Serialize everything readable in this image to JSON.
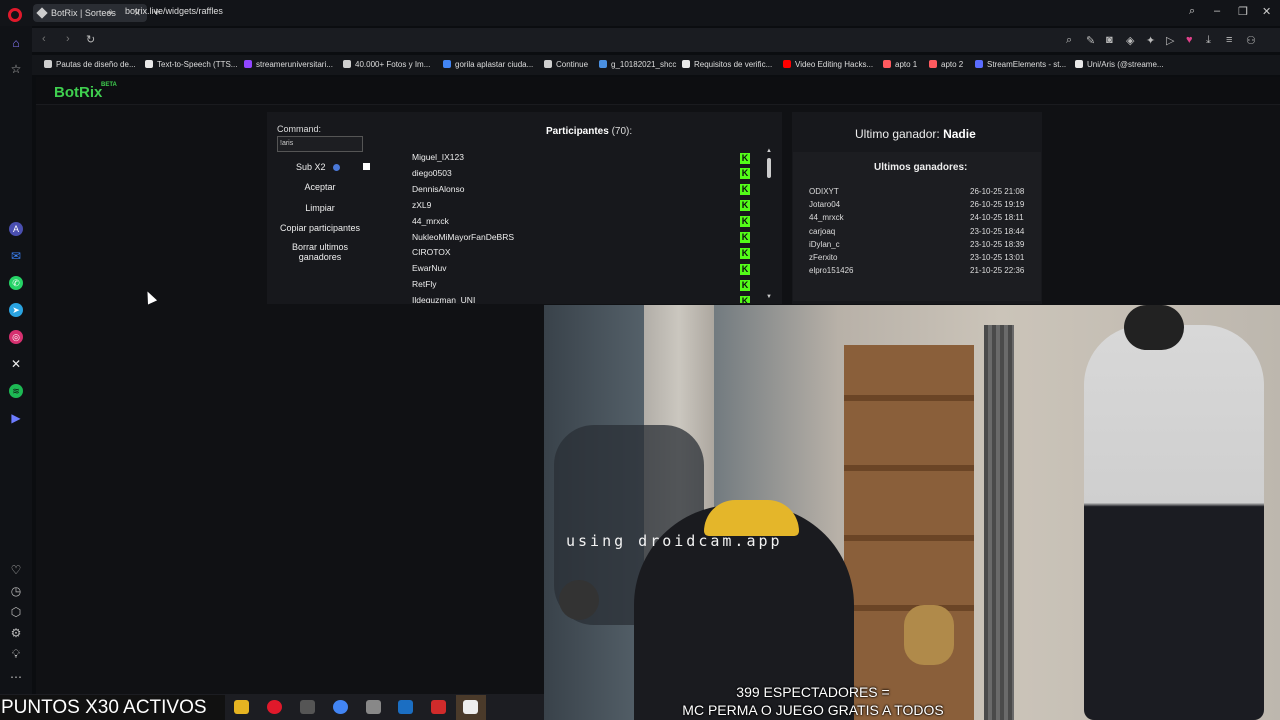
{
  "browser": {
    "tab_title": "BotRix | Sorteos",
    "tab_close": "✕",
    "new_tab": "+",
    "url": "botrix.live/widgets/raffles",
    "bookmarks": [
      {
        "label": "Pautas de diseño de...",
        "icon": "document-icon",
        "color": "#cfcfcf"
      },
      {
        "label": "Text-to-Speech (TTS...",
        "icon": "tts-icon",
        "color": "#e8e8e8"
      },
      {
        "label": "streameruniversitari...",
        "icon": "twitch-icon",
        "color": "#9146ff"
      },
      {
        "label": "40.000+ Fotos y Im...",
        "icon": "p-icon",
        "color": "#cfcfcf"
      },
      {
        "label": "gorila aplastar ciuda...",
        "icon": "google-icon",
        "color": "#4285f4"
      },
      {
        "label": "Continue",
        "icon": "document-icon",
        "color": "#cfcfcf"
      },
      {
        "label": "g_10182021_shcc",
        "icon": "cloud-icon",
        "color": "#4a90e2"
      },
      {
        "label": "Requisitos de verific...",
        "icon": "x-icon",
        "color": "#e8e8e8"
      },
      {
        "label": "Video Editing Hacks...",
        "icon": "youtube-icon",
        "color": "#ff0000"
      },
      {
        "label": "apto 1",
        "icon": "airbnb-icon",
        "color": "#ff5a5f"
      },
      {
        "label": "apto 2",
        "icon": "airbnb-icon",
        "color": "#ff5a5f"
      },
      {
        "label": "StreamElements - st...",
        "icon": "streamelements-icon",
        "color": "#5a6cff"
      },
      {
        "label": "Uni/Aris (@streame...",
        "icon": "tiktok-icon",
        "color": "#e8e8e8"
      }
    ]
  },
  "botrix": {
    "logo": "BotRix",
    "beta": "BETA"
  },
  "raffle": {
    "command_label": "Command:",
    "command_value": "!aris",
    "sub_label": "Sub X2",
    "accept": "Aceptar",
    "clear": "Limpiar",
    "copy": "Copiar participantes",
    "delete_winners": "Borrar ultimos ganadores",
    "participants_label": "Participantes",
    "participants_count": "(70):",
    "participants": [
      "Miguel_IX123",
      "diego0503",
      "DennisAlonso",
      "zXL9",
      "44_mrxck",
      "NukleoMiMayorFanDeBRS",
      "CIROTOX",
      "EwarNuv",
      "RetFly",
      "Ildeguzman_UNI"
    ]
  },
  "winners": {
    "last_winner_label": "Ultimo ganador:",
    "last_winner_name": "Nadie",
    "recent_title": "Ultimos ganadores:",
    "list": [
      {
        "name": "ODIXYT",
        "date": "26-10-25 21:08"
      },
      {
        "name": "Jotaro04",
        "date": "26-10-25 19:19"
      },
      {
        "name": "44_mrxck",
        "date": "24-10-25 18:11"
      },
      {
        "name": "carjoaq",
        "date": "23-10-25 18:44"
      },
      {
        "name": "iDylan_c",
        "date": "23-10-25 18:39"
      },
      {
        "name": "zFerxito",
        "date": "23-10-25 13:01"
      },
      {
        "name": "elpro151426",
        "date": "21-10-25 22:36"
      }
    ]
  },
  "stream": {
    "watermark": "using droidcam.app",
    "overlay_line1": "399 ESPECTADORES =",
    "overlay_line2": "MC PERMA O JUEGO GRATIS A TODOS",
    "ticker": "PUNTOS X30 ACTIVOS"
  },
  "colors": {
    "kick_green": "#53fc18",
    "botrix_green": "#3fcf4f",
    "opera_red": "#e0192b"
  }
}
